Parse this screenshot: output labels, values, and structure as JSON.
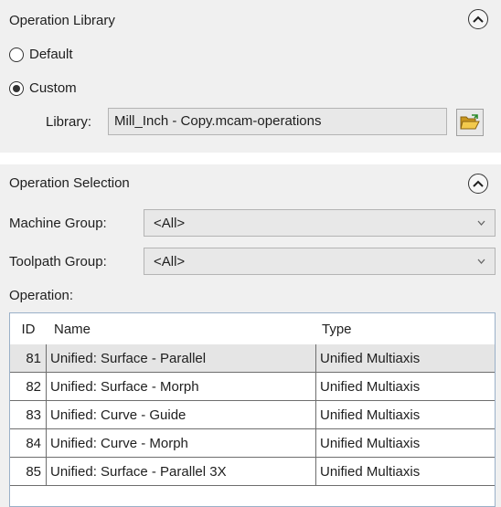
{
  "operation_library": {
    "title": "Operation Library",
    "radio_default_label": "Default",
    "radio_custom_label": "Custom",
    "selected_option": "Custom",
    "library_label": "Library:",
    "library_value": "Mill_Inch - Copy.mcam-operations"
  },
  "operation_selection": {
    "title": "Operation Selection",
    "machine_group_label": "Machine Group:",
    "machine_group_value": "<All>",
    "toolpath_group_label": "Toolpath Group:",
    "toolpath_group_value": "<All>",
    "operation_label": "Operation:",
    "table": {
      "headers": {
        "id": "ID",
        "name": "Name",
        "type": "Type"
      },
      "rows": [
        {
          "id": "81",
          "name": "Unified: Surface - Parallel",
          "type": "Unified Multiaxis"
        },
        {
          "id": "82",
          "name": "Unified: Surface - Morph",
          "type": "Unified Multiaxis"
        },
        {
          "id": "83",
          "name": "Unified: Curve - Guide",
          "type": "Unified Multiaxis"
        },
        {
          "id": "84",
          "name": "Unified: Curve - Morph",
          "type": "Unified Multiaxis"
        },
        {
          "id": "85",
          "name": "Unified: Surface - Parallel 3X",
          "type": "Unified Multiaxis"
        }
      ],
      "selected_row": "81"
    }
  },
  "icons": {
    "collapse": "chevron-up-icon",
    "dropdown": "chevron-down-icon",
    "browse": "open-folder-icon"
  },
  "colors": {
    "panel_bg": "#f0f0f0",
    "field_bg": "#e8e8e8",
    "selected_row_bg": "#e5e5e5",
    "table_border": "#9ab0c8",
    "folder_yellow": "#e8b830"
  }
}
